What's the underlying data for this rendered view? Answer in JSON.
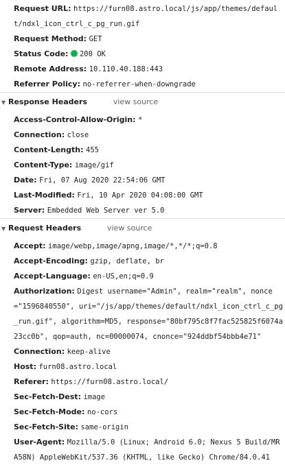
{
  "general": {
    "request_url": {
      "key": "Request URL:",
      "value": "https://furn08.astro.local/js/app/themes/default/ndxl_icon_ctrl_c_pg_run.gif"
    },
    "request_method": {
      "key": "Request Method:",
      "value": "GET"
    },
    "status_code": {
      "key": "Status Code:",
      "value": "200 OK",
      "color": "#0ab24c"
    },
    "remote_address": {
      "key": "Remote Address:",
      "value": "10.110.40.188:443"
    },
    "referrer_policy": {
      "key": "Referrer Policy:",
      "value": "no-referrer-when-downgrade"
    }
  },
  "response_headers": {
    "title": "Response Headers",
    "view_source": "view source",
    "items": [
      {
        "key": "Access-Control-Allow-Origin:",
        "value": "*"
      },
      {
        "key": "Connection:",
        "value": "close"
      },
      {
        "key": "Content-Length:",
        "value": "455"
      },
      {
        "key": "Content-Type:",
        "value": "image/gif"
      },
      {
        "key": "Date:",
        "value": "Fri, 07 Aug 2020 22:54:06 GMT"
      },
      {
        "key": "Last-Modified:",
        "value": "Fri, 10 Apr 2020 04:08:00 GMT"
      },
      {
        "key": "Server:",
        "value": "Embedded Web Server ver 5.0"
      }
    ]
  },
  "request_headers": {
    "title": "Request Headers",
    "view_source": "view source",
    "items": [
      {
        "key": "Accept:",
        "value": "image/webp,image/apng,image/*,*/*;q=0.8"
      },
      {
        "key": "Accept-Encoding:",
        "value": "gzip, deflate, br"
      },
      {
        "key": "Accept-Language:",
        "value": "en-US,en;q=0.9"
      },
      {
        "key": "Authorization:",
        "value": "Digest username=\"Admin\", realm=\"realm\", nonce=\"1596840550\", uri=\"/js/app/themes/default/ndxl_icon_ctrl_c_pg_run.gif\", algorithm=MD5, response=\"80bf795c8f7fac525825f6074a23cc0b\", qop=auth, nc=00000074, cnonce=\"924ddbf54bbb4e71\""
      },
      {
        "key": "Connection:",
        "value": "keep-alive"
      },
      {
        "key": "Host:",
        "value": "furn08.astro.local"
      },
      {
        "key": "Referer:",
        "value": "https://furn08.astro.local/"
      },
      {
        "key": "Sec-Fetch-Dest:",
        "value": "image"
      },
      {
        "key": "Sec-Fetch-Mode:",
        "value": "no-cors"
      },
      {
        "key": "Sec-Fetch-Site:",
        "value": "same-origin"
      },
      {
        "key": "User-Agent:",
        "value": "Mozilla/5.0 (Linux; Android 6.0; Nexus 5 Build/MRA58N) AppleWebKit/537.36 (KHTML, like Gecko) Chrome/84.0.41"
      }
    ]
  }
}
